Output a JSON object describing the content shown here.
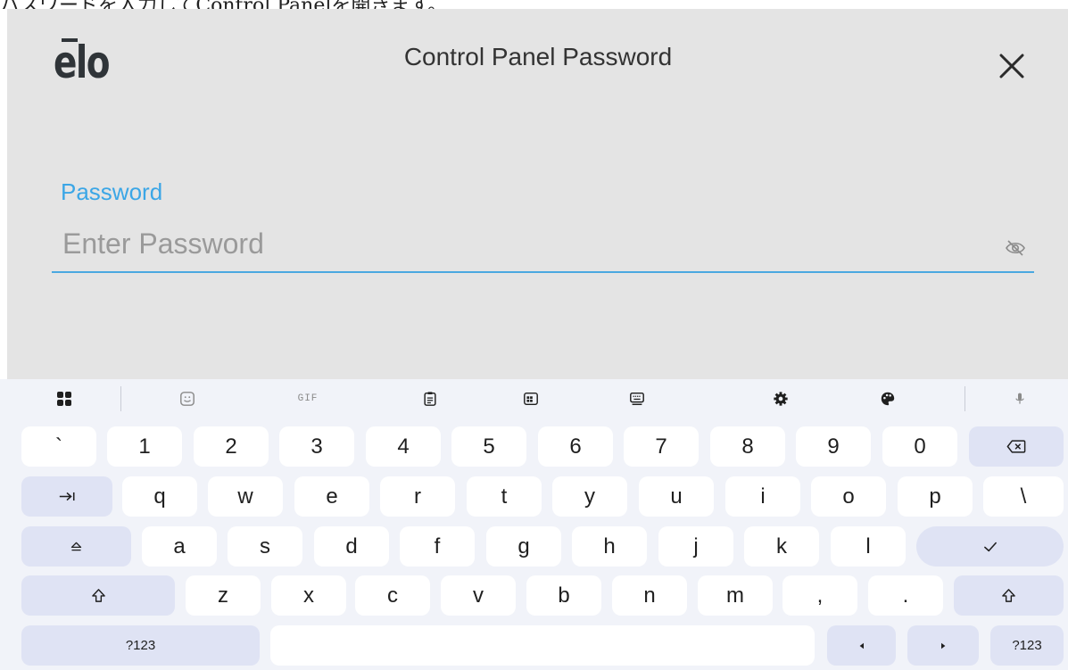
{
  "caption": "パスワードを入力してControl Panelを開きます。",
  "dialog": {
    "logo": "elo",
    "title": "Control Panel Password",
    "close_icon": "close-icon",
    "password_label": "Password",
    "password_placeholder": "Enter Password",
    "password_value": "",
    "visibility_icon": "eye-off-icon"
  },
  "keyboard": {
    "toolbar": [
      "apps-grid-icon",
      "sticker-icon",
      "gif-icon",
      "clipboard-icon",
      "one-handed-icon",
      "keyboard-layout-icon",
      "settings-icon",
      "palette-icon",
      "mic-icon"
    ],
    "toolbar_gif_label": "GIF",
    "row1": [
      "`",
      "1",
      "2",
      "3",
      "4",
      "5",
      "6",
      "7",
      "8",
      "9",
      "0"
    ],
    "row2": [
      "q",
      "w",
      "e",
      "r",
      "t",
      "y",
      "u",
      "i",
      "o",
      "p",
      "\\"
    ],
    "row3": [
      "a",
      "s",
      "d",
      "f",
      "g",
      "h",
      "j",
      "k",
      "l"
    ],
    "row4": [
      "z",
      "x",
      "c",
      "v",
      "b",
      "n",
      "m",
      ",",
      "."
    ],
    "symbols_label": "?123",
    "symbols_label_right": "?123",
    "colors": {
      "key_bg": "#ffffff",
      "fn_key_bg": "#dfe3f4",
      "keyboard_bg": "#f1f3f9",
      "accent": "#3ba6e6",
      "dialog_bg": "#e4e4e4"
    }
  }
}
